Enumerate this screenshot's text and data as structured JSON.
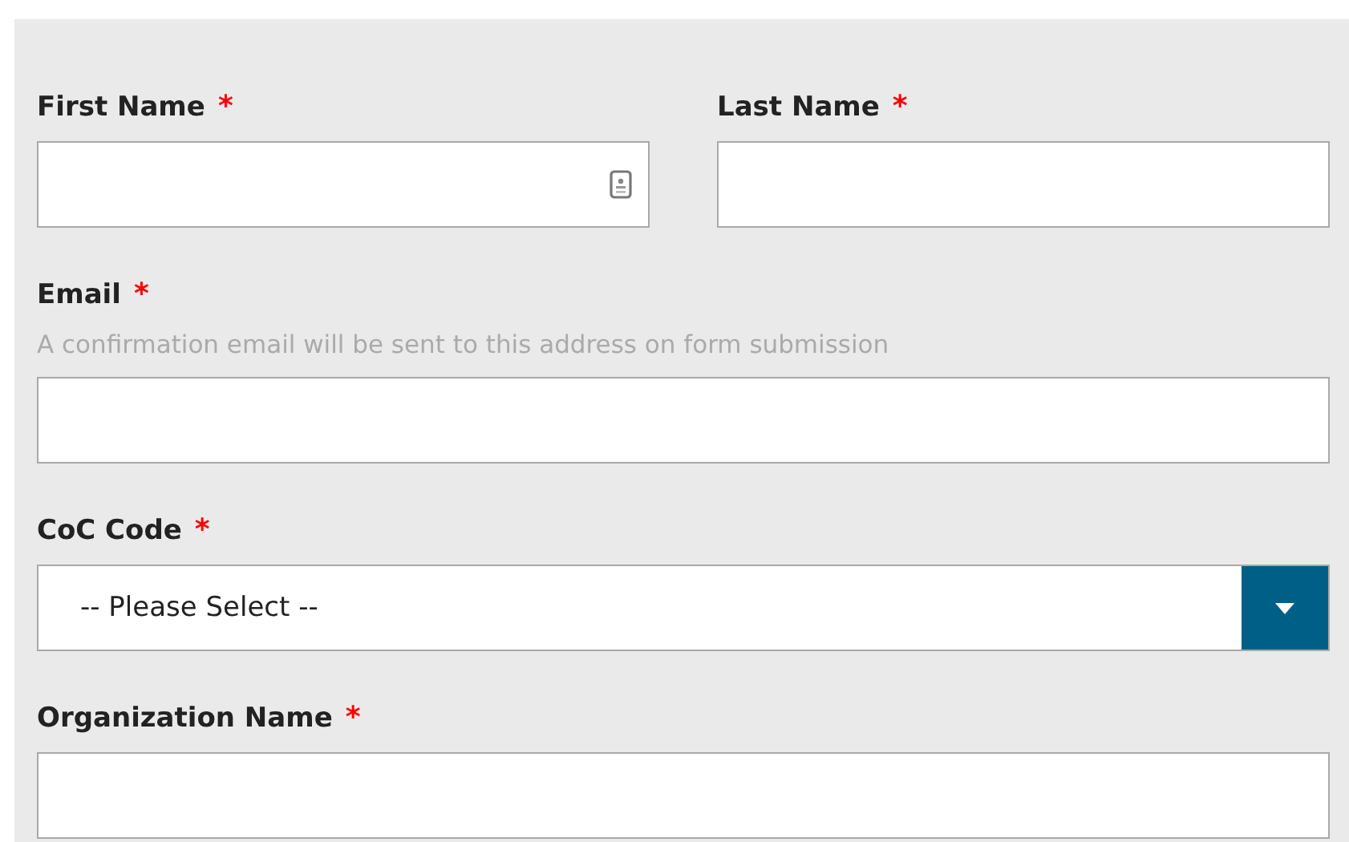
{
  "fields": [
    {
      "kind": "text",
      "label": "First Name",
      "required_mark": "*",
      "autofill_icon": true
    },
    {
      "kind": "text",
      "label": "Last Name",
      "required_mark": "*"
    },
    {
      "kind": "text",
      "label": "Email",
      "required_mark": "*",
      "hint": "A confirmation email will be sent to this address on form submission"
    },
    {
      "kind": "select",
      "label": "CoC Code",
      "required_mark": "*",
      "value": "-- Please Select --"
    },
    {
      "kind": "text",
      "label": "Organization Name",
      "required_mark": "*"
    }
  ]
}
